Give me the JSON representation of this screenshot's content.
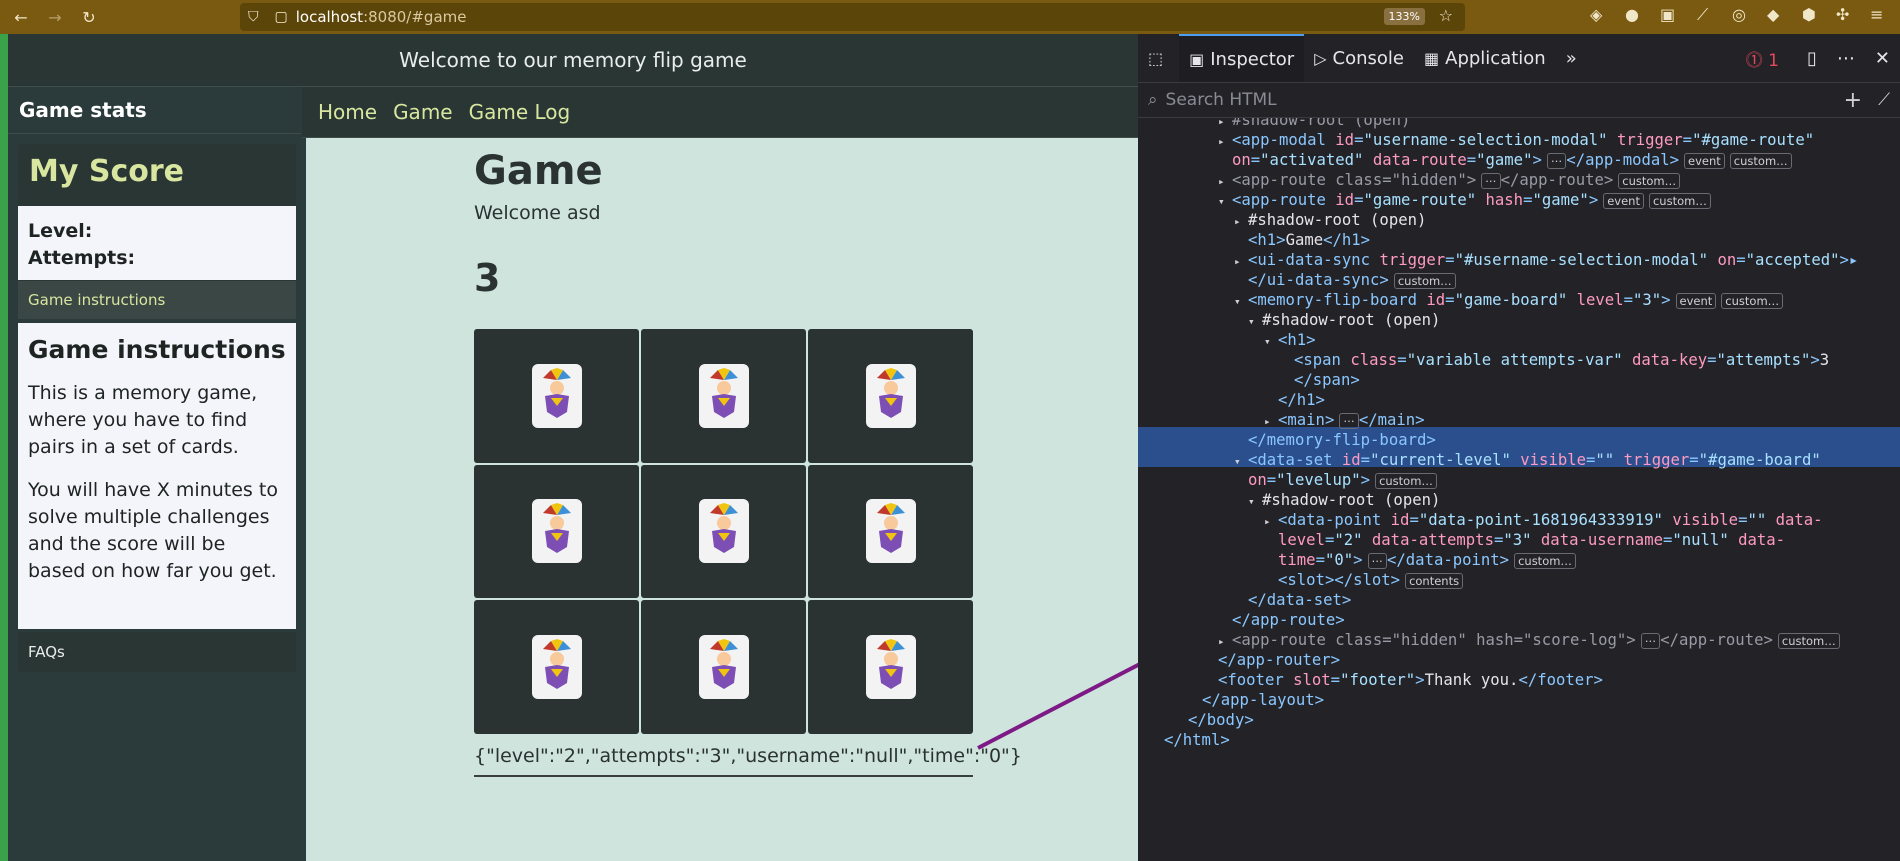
{
  "browser": {
    "url_host": "localhost",
    "url_path": ":8080/#game",
    "zoom": "133%"
  },
  "page": {
    "header_title": "Welcome to our memory flip game",
    "sidebar": {
      "title": "Game stats",
      "score_title": "My Score",
      "level_label": "Level:",
      "attempts_label": "Attempts:",
      "instructions_tab": "Game instructions",
      "instructions_heading": "Game instructions",
      "instructions_p1": "This is a memory game, where you have to find pairs in a set of cards.",
      "instructions_p2": "You will have X minutes to solve multiple challenges and the score will be based on how far you get.",
      "faqs": "FAQs"
    },
    "nav": {
      "home": "Home",
      "game": "Game",
      "game_log": "Game Log"
    },
    "main": {
      "title": "Game",
      "welcome": "Welcome asd",
      "attempts_value": "3",
      "cards_count": 9,
      "json_output": "{\"level\":\"2\",\"attempts\":\"3\",\"username\":\"null\",\"time\":\"0\"}"
    }
  },
  "devtools": {
    "tabs": {
      "inspector": "Inspector",
      "console": "Console",
      "application": "Application"
    },
    "error_count": "1",
    "search_placeholder": "Search HTML",
    "lines": {
      "l0": "#shadow-root (open)",
      "l3": "#shadow-root (open)",
      "l6": "#shadow-root (open)",
      "l7": "<h1>",
      "l12": "#shadow-root (open)",
      "l13": "<slot></slot>",
      "l14": "</data-set>",
      "l15": "</app-route>",
      "l16": "</app-router>",
      "l18": "</app-layout>",
      "l19": "</body>",
      "l20": "</html>",
      "l21": "</h1>",
      "l22": "</memory-flip-board>"
    },
    "badges": {
      "event": "event",
      "custom": "custom…",
      "contents": "contents"
    }
  }
}
